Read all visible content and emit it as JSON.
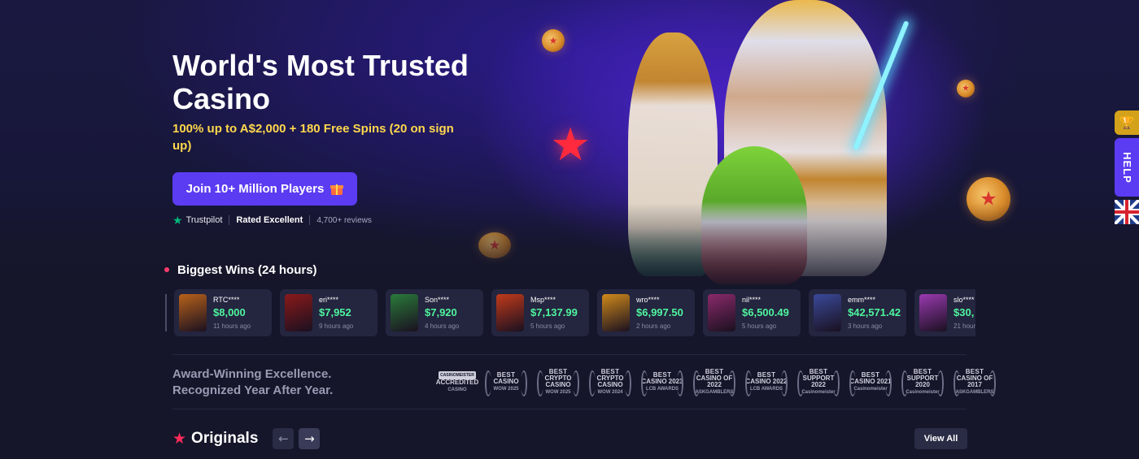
{
  "hero": {
    "title": "World's Most Trusted Casino",
    "subtitle": "100% up to A$2,000 + 180 Free Spins (20 on sign up)",
    "cta_label": "Join 10+ Million Players",
    "cta_icon": "gift-icon",
    "trustpilot": {
      "brand": "Trustpilot",
      "rating_text": "Rated Excellent",
      "reviews_text": "4,700+ reviews",
      "star_color": "#00b67a"
    }
  },
  "side": {
    "trophy_icon": "trophy-icon",
    "help_label": "HELP",
    "language_icon": "uk-flag-icon"
  },
  "wins": {
    "heading": "Biggest Wins (24 hours)",
    "items": [
      {
        "user": "RTC****",
        "amount": "$8,000",
        "time": "11 hours ago",
        "color": "#b8621a"
      },
      {
        "user": "eri****",
        "amount": "$7,952",
        "time": "9 hours ago",
        "color": "#8a1a1a"
      },
      {
        "user": "Son****",
        "amount": "$7,920",
        "time": "4 hours ago",
        "color": "#2a7a3a"
      },
      {
        "user": "Msp****",
        "amount": "$7,137.99",
        "time": "5 hours ago",
        "color": "#c23a1a"
      },
      {
        "user": "wro****",
        "amount": "$6,997.50",
        "time": "2 hours ago",
        "color": "#d08a1a"
      },
      {
        "user": "nil****",
        "amount": "$6,500.49",
        "time": "5 hours ago",
        "color": "#8a2a6a"
      },
      {
        "user": "emm****",
        "amount": "$42,571.42",
        "time": "3 hours ago",
        "color": "#3a4a9a"
      },
      {
        "user": "slo****",
        "amount": "$30,",
        "time": "21 hours",
        "color": "#9a3ab0"
      }
    ]
  },
  "awards": {
    "line1": "Award-Winning Excellence.",
    "line2": "Recognized Year After Year.",
    "badges": [
      {
        "top": "CASINOMEISTER",
        "main": "ACCREDITED",
        "sub": "CASINO"
      },
      {
        "top": "BEST",
        "main": "CASINO",
        "sub": "WOW 2025"
      },
      {
        "top": "BEST",
        "main": "CRYPTO CASINO",
        "sub": "WOW 2025"
      },
      {
        "top": "BEST",
        "main": "CRYPTO CASINO",
        "sub": "WOW 2024"
      },
      {
        "top": "BEST",
        "main": "CASINO 2023",
        "sub": "LCB AWARDS"
      },
      {
        "top": "BEST",
        "main": "CASINO OF 2022",
        "sub": "ASKGAMBLERS"
      },
      {
        "top": "BEST",
        "main": "CASINO 2022",
        "sub": "LCB AWARDS"
      },
      {
        "top": "BEST",
        "main": "SUPPORT 2022",
        "sub": "Casinomeister"
      },
      {
        "top": "BEST",
        "main": "CASINO 2021",
        "sub": "Casinomeister"
      },
      {
        "top": "BEST",
        "main": "SUPPORT 2020",
        "sub": "Casinomeister"
      },
      {
        "top": "BEST",
        "main": "CASINO OF 2017",
        "sub": "ASKGAMBLERS"
      }
    ]
  },
  "originals": {
    "title": "Originals",
    "prev_icon": "arrow-left-icon",
    "next_icon": "arrow-right-icon",
    "prev_glyph": "←",
    "next_glyph": "→",
    "view_all_label": "View All"
  }
}
